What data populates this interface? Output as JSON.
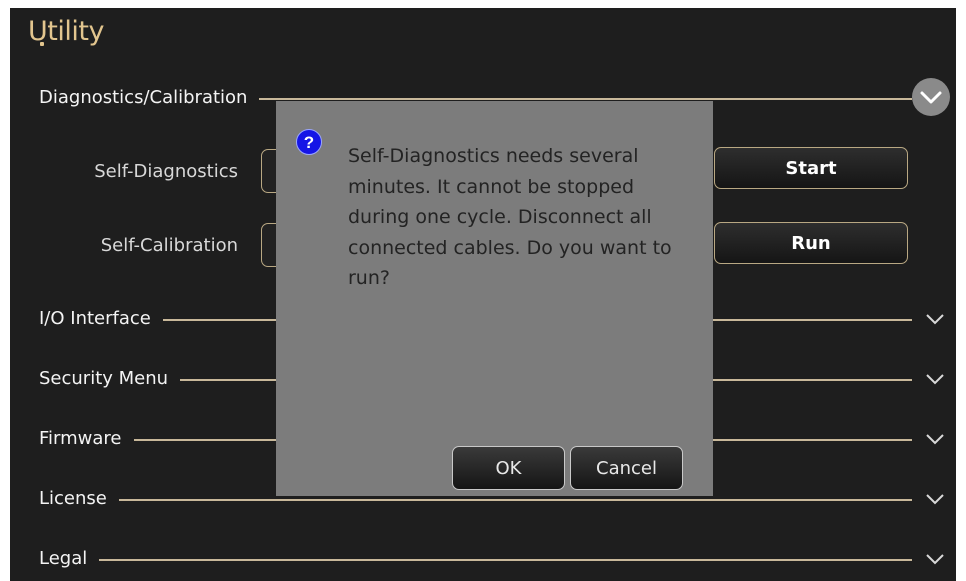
{
  "header": {
    "title": "Utility"
  },
  "sections": {
    "diagnostics": {
      "label": "Diagnostics/Calibration"
    },
    "io": {
      "label": "I/O Interface"
    },
    "security": {
      "label": "Security Menu"
    },
    "firmware": {
      "label": "Firmware"
    },
    "license": {
      "label": "License"
    },
    "legal": {
      "label": "Legal"
    }
  },
  "diagnostics_rows": {
    "self_diag": {
      "label": "Self-Diagnostics",
      "button": "Start"
    },
    "self_cal": {
      "label": "Self-Calibration",
      "button": "Run"
    }
  },
  "dialog": {
    "icon": "question-icon",
    "message": "Self-Diagnostics needs several minutes. It cannot be stopped during one cycle. Disconnect all connected cables. Do you want to run?",
    "ok_label": "OK",
    "cancel_label": "Cancel"
  },
  "colors": {
    "background": "#1e1e1e",
    "title": "#e2c58e",
    "accent_line": "#c8b89a",
    "dialog_bg": "#7c7c7c",
    "question_icon": "#1515e6"
  }
}
